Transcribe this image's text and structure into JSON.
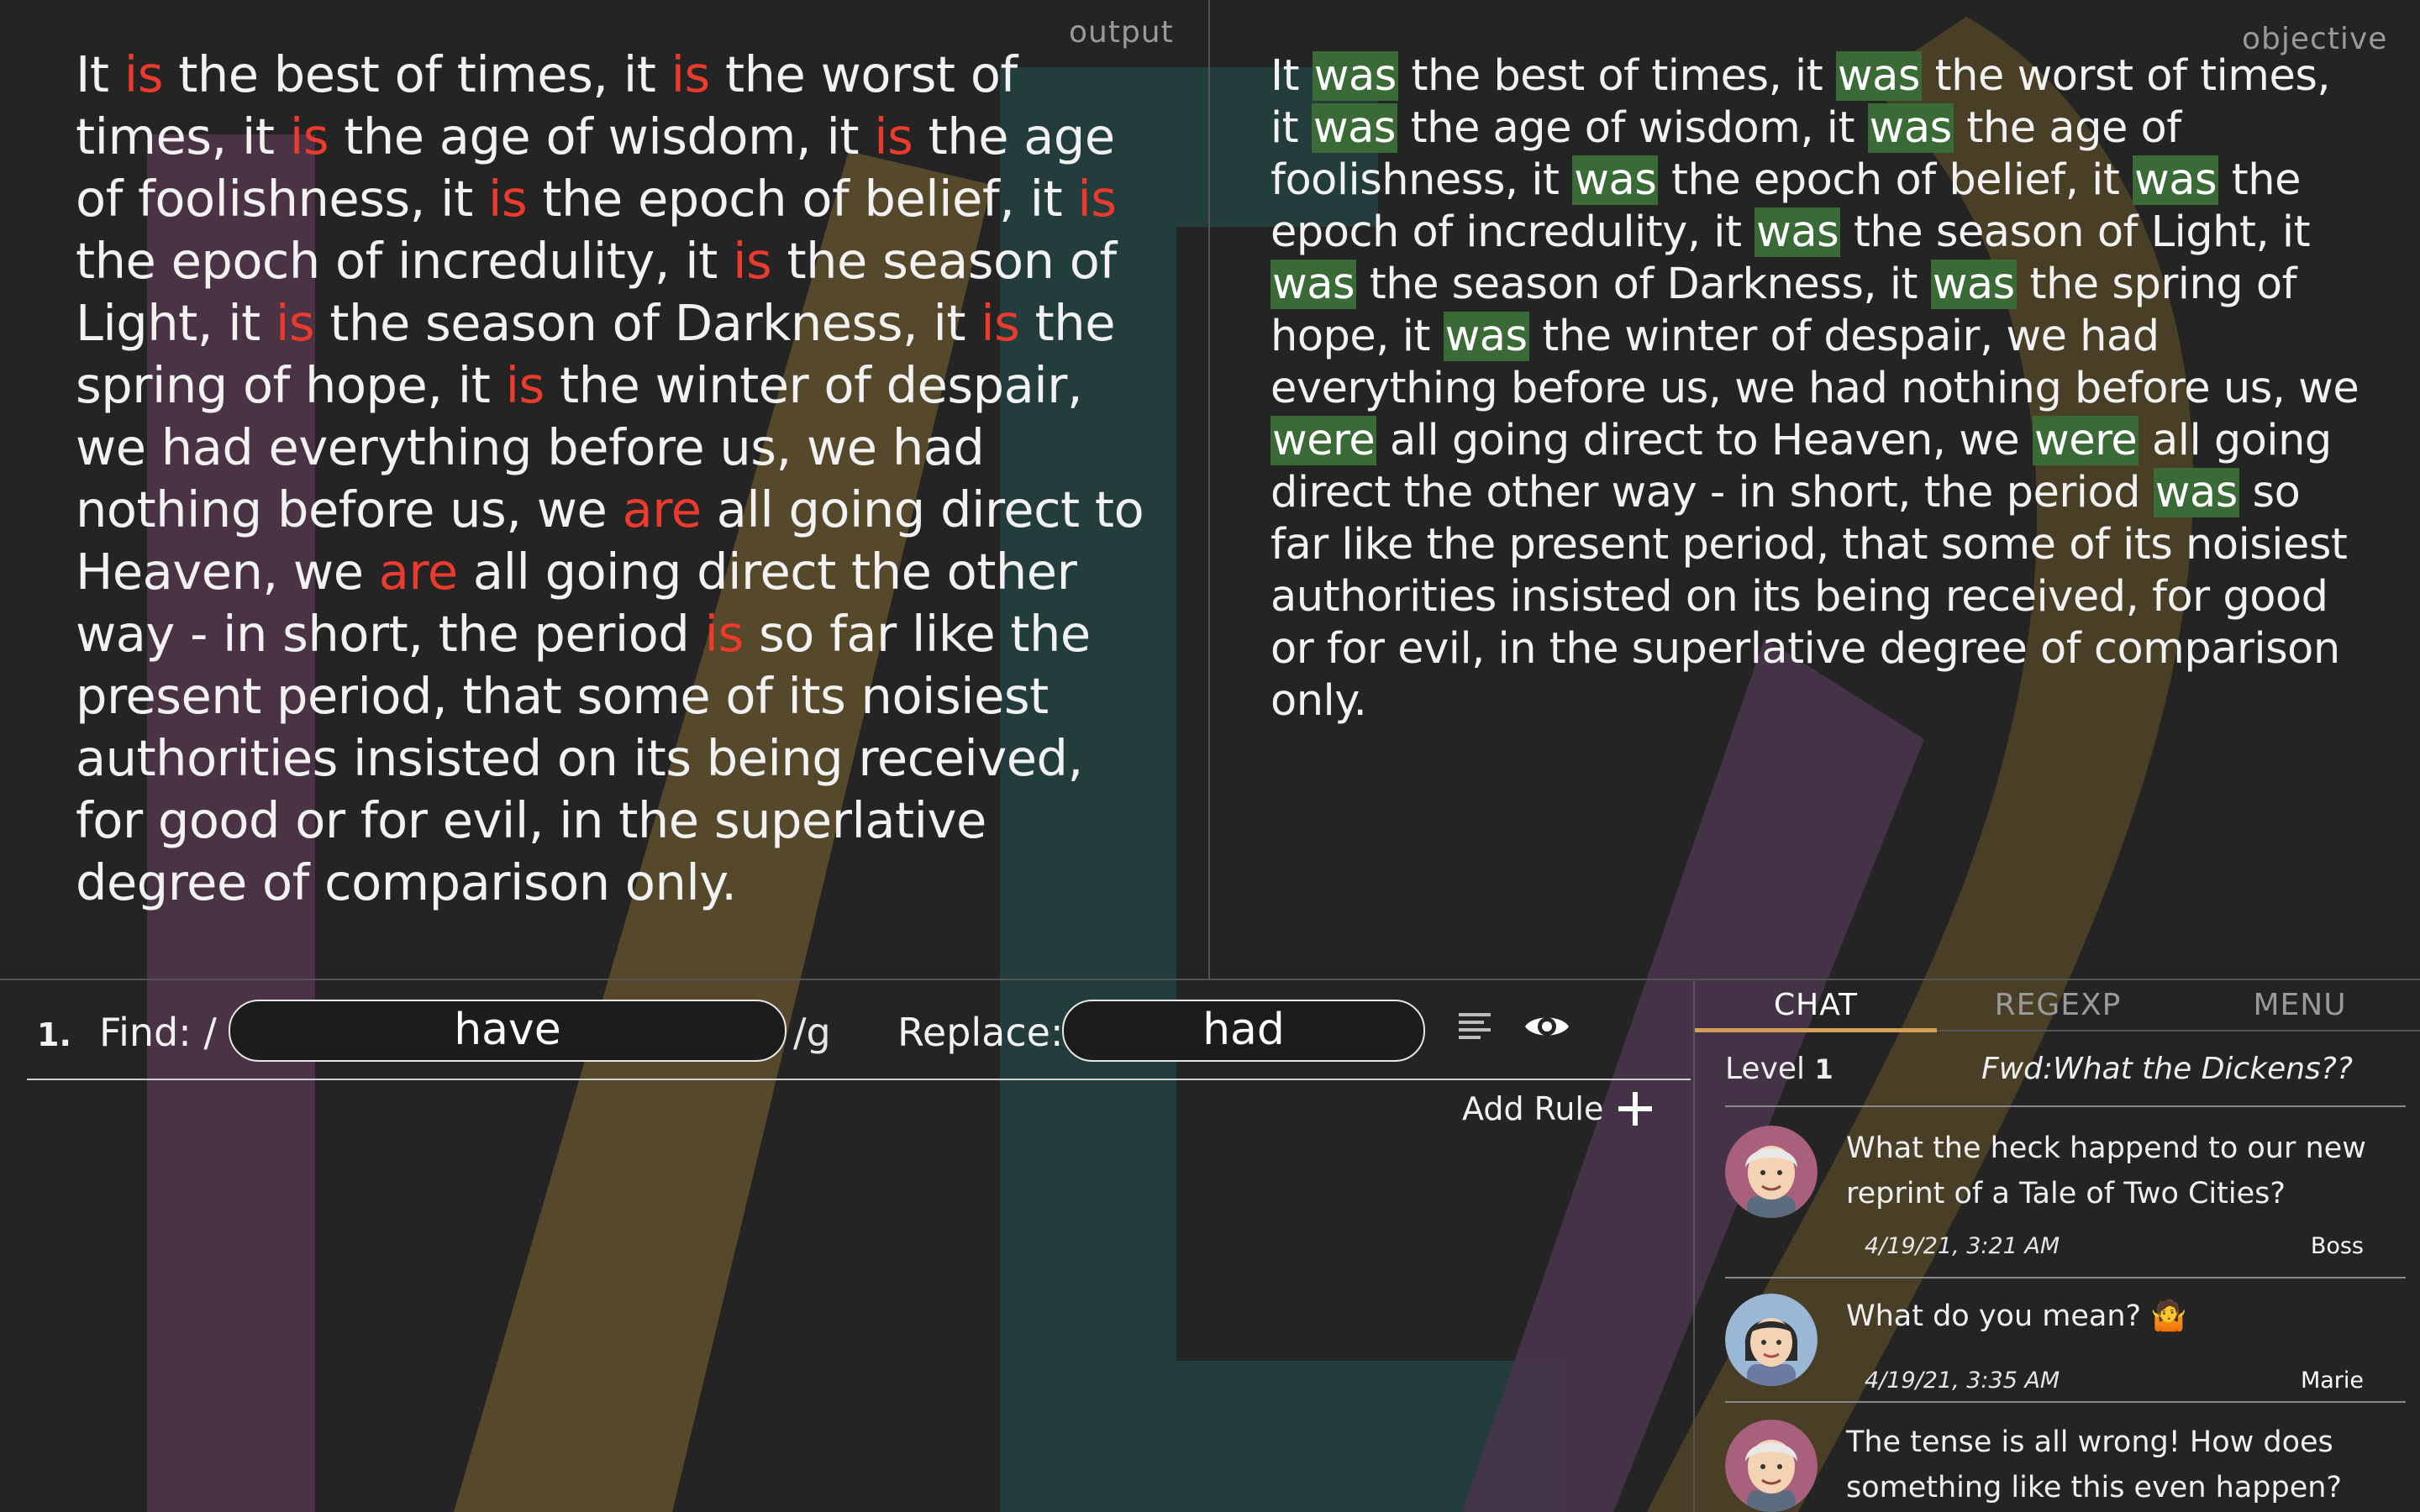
{
  "labels": {
    "output": "output",
    "objective": "objective"
  },
  "output_segments": [
    {
      "t": "It ",
      "h": false
    },
    {
      "t": "is",
      "h": true
    },
    {
      "t": " the best of times, it ",
      "h": false
    },
    {
      "t": "is",
      "h": true
    },
    {
      "t": " the worst of times, it ",
      "h": false
    },
    {
      "t": "is",
      "h": true
    },
    {
      "t": " the age of wisdom, it ",
      "h": false
    },
    {
      "t": "is",
      "h": true
    },
    {
      "t": " the age of foolishness, it ",
      "h": false
    },
    {
      "t": "is",
      "h": true
    },
    {
      "t": " the epoch of belief, it ",
      "h": false
    },
    {
      "t": "is",
      "h": true
    },
    {
      "t": " the epoch of incredulity, it ",
      "h": false
    },
    {
      "t": "is",
      "h": true
    },
    {
      "t": " the season of Light, it ",
      "h": false
    },
    {
      "t": "is",
      "h": true
    },
    {
      "t": " the season of Darkness, it ",
      "h": false
    },
    {
      "t": "is",
      "h": true
    },
    {
      "t": " the spring of hope, it ",
      "h": false
    },
    {
      "t": "is",
      "h": true
    },
    {
      "t": " the winter of despair, we had everything before us, we had nothing before us, we ",
      "h": false
    },
    {
      "t": "are",
      "h": true
    },
    {
      "t": " all going direct to Heaven, we ",
      "h": false
    },
    {
      "t": "are",
      "h": true
    },
    {
      "t": " all going direct the other way - in short, the period ",
      "h": false
    },
    {
      "t": "is",
      "h": true
    },
    {
      "t": " so far like the present period, that some of its noisiest authorities insisted on its being received, for good or for evil, in the superlative degree of comparison only.",
      "h": false
    }
  ],
  "objective_segments": [
    {
      "t": "It ",
      "h": false
    },
    {
      "t": "was",
      "h": true
    },
    {
      "t": " the best of times, it ",
      "h": false
    },
    {
      "t": "was",
      "h": true
    },
    {
      "t": " the worst of times, it ",
      "h": false
    },
    {
      "t": "was",
      "h": true
    },
    {
      "t": " the age of wisdom, it ",
      "h": false
    },
    {
      "t": "was",
      "h": true
    },
    {
      "t": " the age of foolishness, it ",
      "h": false
    },
    {
      "t": "was",
      "h": true
    },
    {
      "t": " the epoch of belief, it ",
      "h": false
    },
    {
      "t": "was",
      "h": true
    },
    {
      "t": " the epoch of incredulity, it ",
      "h": false
    },
    {
      "t": "was",
      "h": true
    },
    {
      "t": " the season of Light, it ",
      "h": false
    },
    {
      "t": "was",
      "h": true
    },
    {
      "t": " the season of Darkness, it ",
      "h": false
    },
    {
      "t": "was",
      "h": true
    },
    {
      "t": " the spring of hope, it ",
      "h": false
    },
    {
      "t": "was",
      "h": true
    },
    {
      "t": " the winter of despair, we had everything before us, we had nothing before us, we ",
      "h": false
    },
    {
      "t": "were",
      "h": true
    },
    {
      "t": " all going direct to Heaven, we ",
      "h": false
    },
    {
      "t": "were",
      "h": true
    },
    {
      "t": " all going direct the other way - in short, the period ",
      "h": false
    },
    {
      "t": "was",
      "h": true
    },
    {
      "t": " so far like the present period, that some of its noisiest authorities insisted on its being received, for good or for evil, in the superlative degree of comparison only.",
      "h": false
    }
  ],
  "rule": {
    "number": "1.",
    "find_label": "Find: /",
    "find_value": "have",
    "flags": "/g",
    "replace_label": "Replace:",
    "replace_value": "had",
    "add_rule_label": "Add Rule"
  },
  "tabs": [
    "CHAT",
    "REGEXP",
    "MENU"
  ],
  "chat": {
    "level_label": "Level",
    "level_number": "1",
    "subject": "Fwd:What the Dickens??",
    "messages": [
      {
        "text": "What the heck happend to our new reprint of a Tale of Two Cities?",
        "time": "4/19/21, 3:21 AM",
        "author": "Boss"
      },
      {
        "text": "What do you mean? 🤷",
        "time": "4/19/21, 3:35 AM",
        "author": "Marie"
      },
      {
        "text": "The tense is all wrong! How does something like this even happen?",
        "time": "",
        "author": ""
      }
    ]
  },
  "colors": {
    "background": "#232423",
    "highlight_red": "#ec3a2d",
    "highlight_green": "#3a6b36",
    "tab_accent": "#d4a05a"
  },
  "icons": [
    "align-left-icon",
    "eye-icon",
    "plus-icon"
  ]
}
